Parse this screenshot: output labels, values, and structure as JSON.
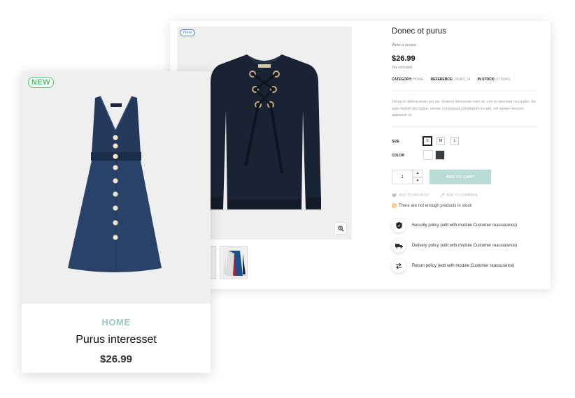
{
  "product_page": {
    "badge": "New",
    "title": "Donec ot purus",
    "review_link": "Write a review",
    "price": "$26.99",
    "tax": "Tax excluded",
    "meta": {
      "category_label": "CATEGORY:",
      "category_value": "HOME",
      "reference_label": "REFERENCE:",
      "reference_value": "DEMO_14",
      "stock_label": "IN STOCK:",
      "stock_value": "0 ITEMS"
    },
    "description": "Detracto deterruisset pro an. Graeco interesset nam te, vim et oporteat recusabo. Ex eam fastidii percipitur, verear consequat voluptatum ex per, vel saepe nemore appareat ut.",
    "size_label": "SIZE",
    "sizes": [
      "S",
      "M",
      "L"
    ],
    "selected_size": "S",
    "color_label": "COLOR",
    "colors": [
      "#ffffff",
      "#3a3d42"
    ],
    "quantity": "1",
    "qty_up": "▲",
    "qty_down": "▼",
    "add_to_cart": "ADD TO CART",
    "add_to_wishlist": "ADD TO WISHLIST",
    "add_to_compare": "ADD TO COMPARE",
    "stock_warning": "There are not enough products in stock",
    "reassurance": [
      {
        "icon": "shield-icon",
        "text": "Security policy (edit with module Customer reassurance)"
      },
      {
        "icon": "truck-icon",
        "text": "Delivery policy (edit with module Customer reassurance)"
      },
      {
        "icon": "exchange-icon",
        "text": "Return policy (edit with module Customer reassurance)"
      }
    ]
  },
  "product_card": {
    "badge": "NEW",
    "category": "HOME",
    "name": "Purus interesset",
    "price": "$26.99"
  },
  "colors": {
    "accent_teal": "#9ac8c2",
    "cart_button": "#b9dbd6",
    "badge_green": "#4fc46a",
    "badge_blue": "#4a7fd4"
  }
}
